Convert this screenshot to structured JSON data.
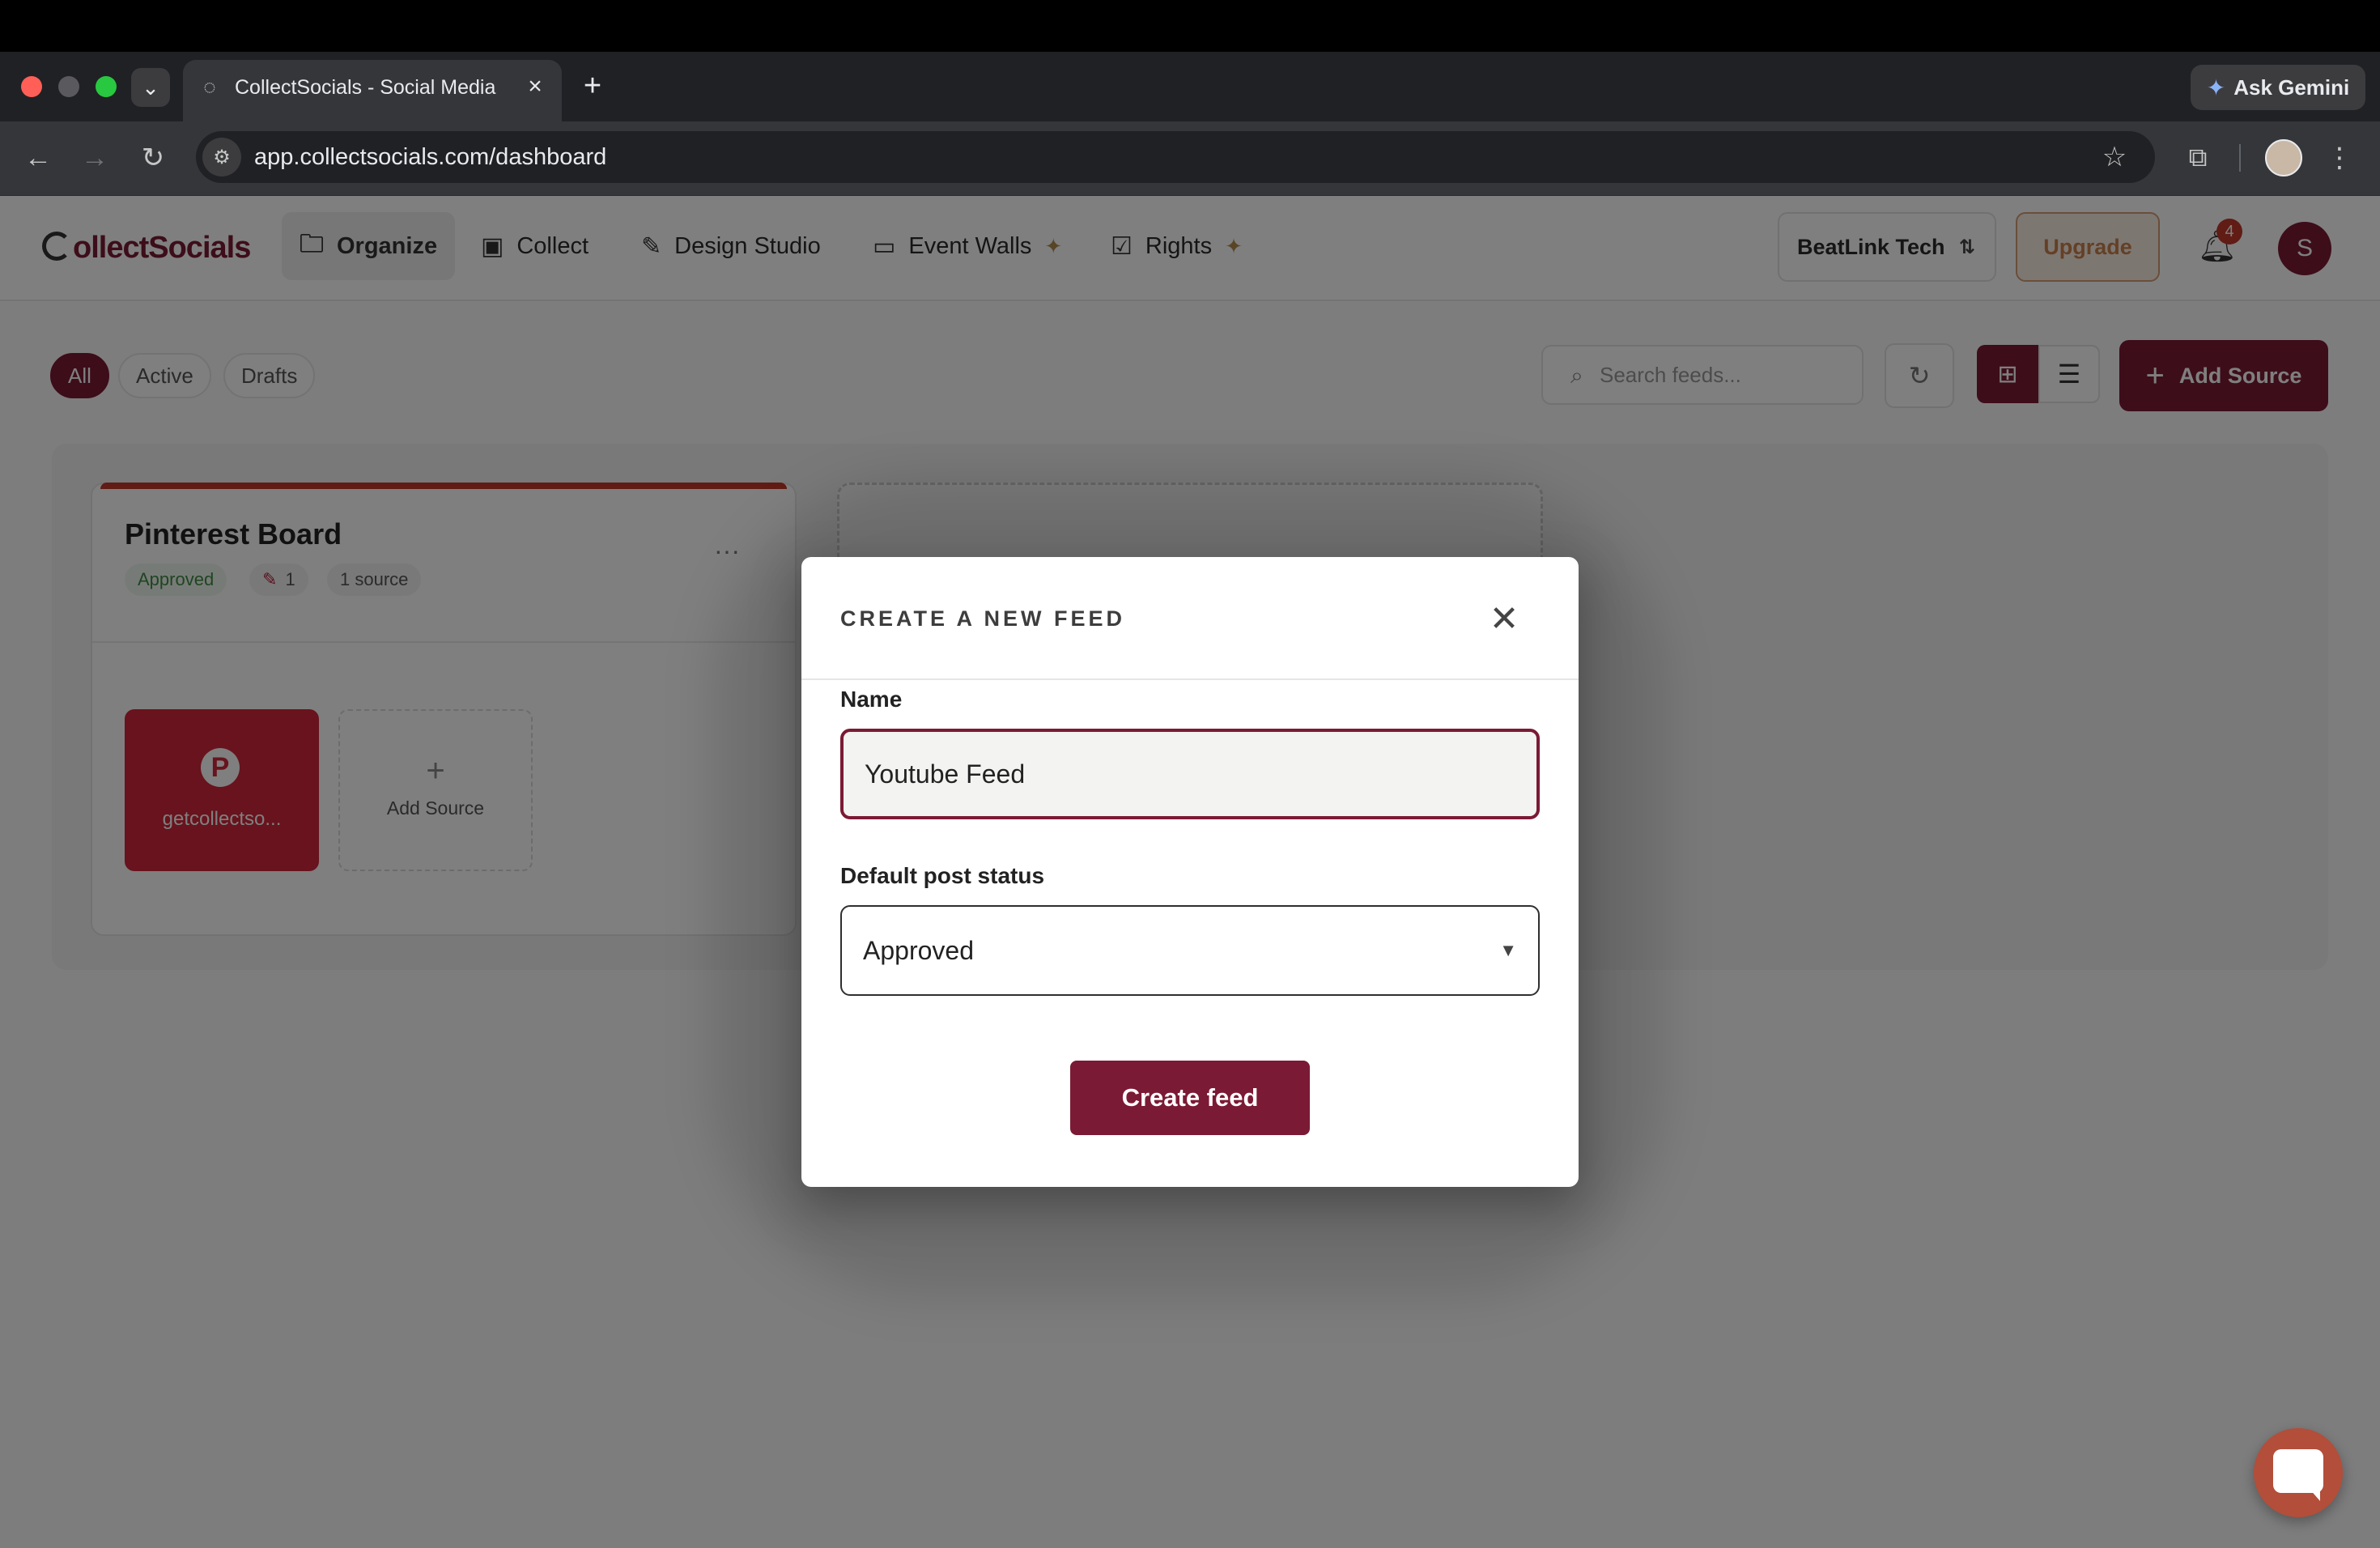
{
  "browser": {
    "tab_title": "CollectSocials - Social Media",
    "url": "app.collectsocials.com/dashboard",
    "ask_gemini": "Ask Gemini",
    "traffic_colors": [
      "#ff5f57",
      "#5a5a5e",
      "#28c840"
    ]
  },
  "app": {
    "logo": "ollectSocials",
    "brand_color": "#7b1a34",
    "nav": [
      {
        "label": "Organize",
        "icon": "folder-icon"
      },
      {
        "label": "Collect",
        "icon": "gallery-icon"
      },
      {
        "label": "Design Studio",
        "icon": "brush-icon"
      },
      {
        "label": "Event Walls",
        "icon": "monitor-icon",
        "sparkle": true
      },
      {
        "label": "Rights",
        "icon": "rights-icon",
        "sparkle": true
      }
    ],
    "workspace": "BeatLink Tech",
    "upgrade": "Upgrade",
    "notifications_count": "4",
    "avatar_initial": "S"
  },
  "toolbar": {
    "filters": [
      "All",
      "Active",
      "Drafts"
    ],
    "active_filter": "All",
    "search_placeholder": "Search feeds...",
    "add_source": "Add Source",
    "view": "grid"
  },
  "feeds": [
    {
      "title": "Pinterest Board",
      "status": "Approved",
      "edits": "1",
      "sources_label": "1 source",
      "sources": [
        {
          "name": "getcollectso...",
          "network": "pinterest"
        }
      ],
      "add_source_label": "Add Source"
    }
  ],
  "modal": {
    "title": "CREATE A NEW FEED",
    "name_label": "Name",
    "name_value": "Youtube Feed",
    "status_label": "Default post status",
    "status_value": "Approved",
    "submit": "Create feed"
  }
}
